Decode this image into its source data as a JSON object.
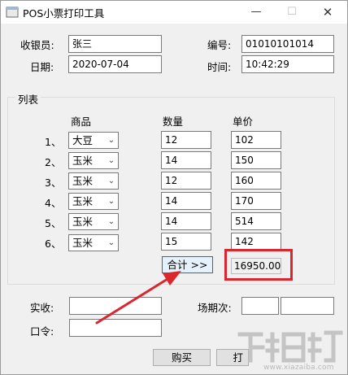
{
  "window": {
    "title": "POS小票打印工具",
    "min_glyph": "—",
    "max_glyph": "☐",
    "close_glyph": "✕"
  },
  "header": {
    "cashier_label": "收银员:",
    "cashier_value": "张三",
    "id_label": "编号:",
    "id_value": "01010101014",
    "date_label": "日期:",
    "date_value": "2020-07-04",
    "time_label": "时间:",
    "time_value": "10:42:29"
  },
  "list": {
    "group_title": "列表",
    "col_product": "商品",
    "col_qty": "数量",
    "col_price": "单价",
    "rows": [
      {
        "no": "1、",
        "product": "大豆",
        "qty": "12",
        "price": "102"
      },
      {
        "no": "2、",
        "product": "玉米",
        "qty": "14",
        "price": "150"
      },
      {
        "no": "3、",
        "product": "玉米",
        "qty": "12",
        "price": "160"
      },
      {
        "no": "4、",
        "product": "玉米",
        "qty": "14",
        "price": "170"
      },
      {
        "no": "5、",
        "product": "玉米",
        "qty": "14",
        "price": "514"
      },
      {
        "no": "6、",
        "product": "玉米",
        "qty": "15",
        "price": "142"
      }
    ],
    "total_button": "合计 >>",
    "total_value": "16950.00"
  },
  "footer": {
    "received_label": "实收:",
    "received_value": "",
    "password_label": "口令:",
    "password_value": "",
    "session_label": "场期次:",
    "session_value_1": "",
    "session_value_2": "",
    "buy_button": "购买",
    "print_button_partial": "打"
  },
  "watermark": {
    "text": "www.xiazaiba.com"
  },
  "colors": {
    "highlight": "#d9262f",
    "window_bg": "#f0f0f0"
  },
  "icons": {
    "dropdown": "chevron-down-icon",
    "app": "app-icon"
  }
}
